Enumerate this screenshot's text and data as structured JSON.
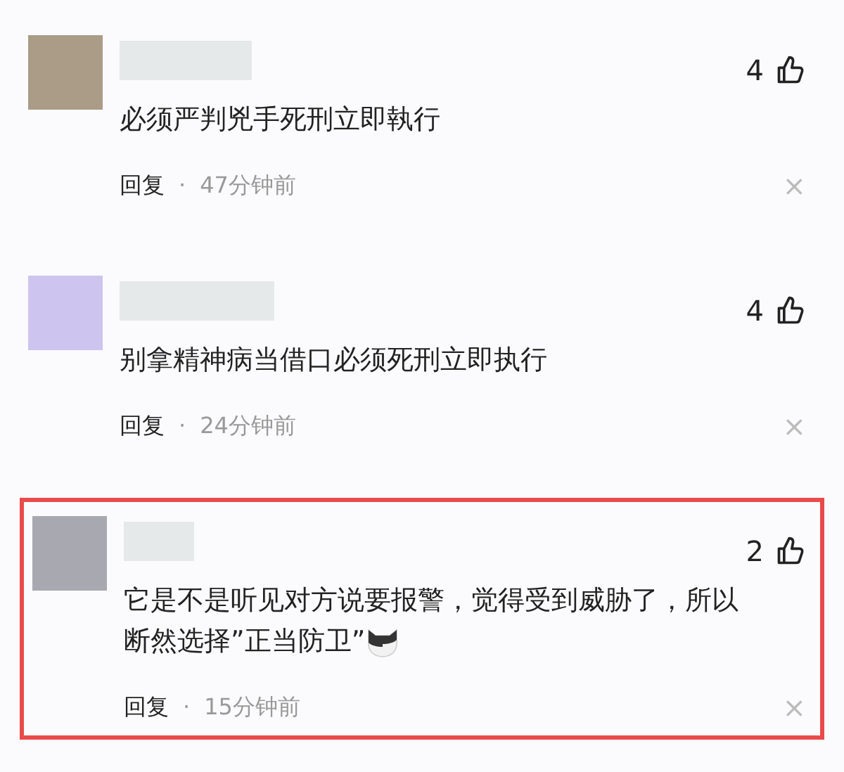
{
  "comments": [
    {
      "color": "#ab9c87",
      "likes": "4",
      "text": "必须严判兇手死刑立即執行",
      "reply": "回复",
      "separator": "·",
      "time": "47分钟前",
      "close": "×",
      "highlighted": false,
      "emoji": false
    },
    {
      "color": "#cdc4ef",
      "likes": "4",
      "text": "别拿精神病当借口必须死刑立即执行",
      "reply": "回复",
      "separator": "·",
      "time": "24分钟前",
      "close": "×",
      "highlighted": false,
      "emoji": false
    },
    {
      "color": "#a8a9b0",
      "likes": "2",
      "text": "它是不是听见对方说要报警，觉得受到威胁了，所以断然选择”正当防卫”",
      "reply": "回复",
      "separator": "·",
      "time": "15分钟前",
      "close": "×",
      "highlighted": true,
      "emoji": true
    }
  ]
}
